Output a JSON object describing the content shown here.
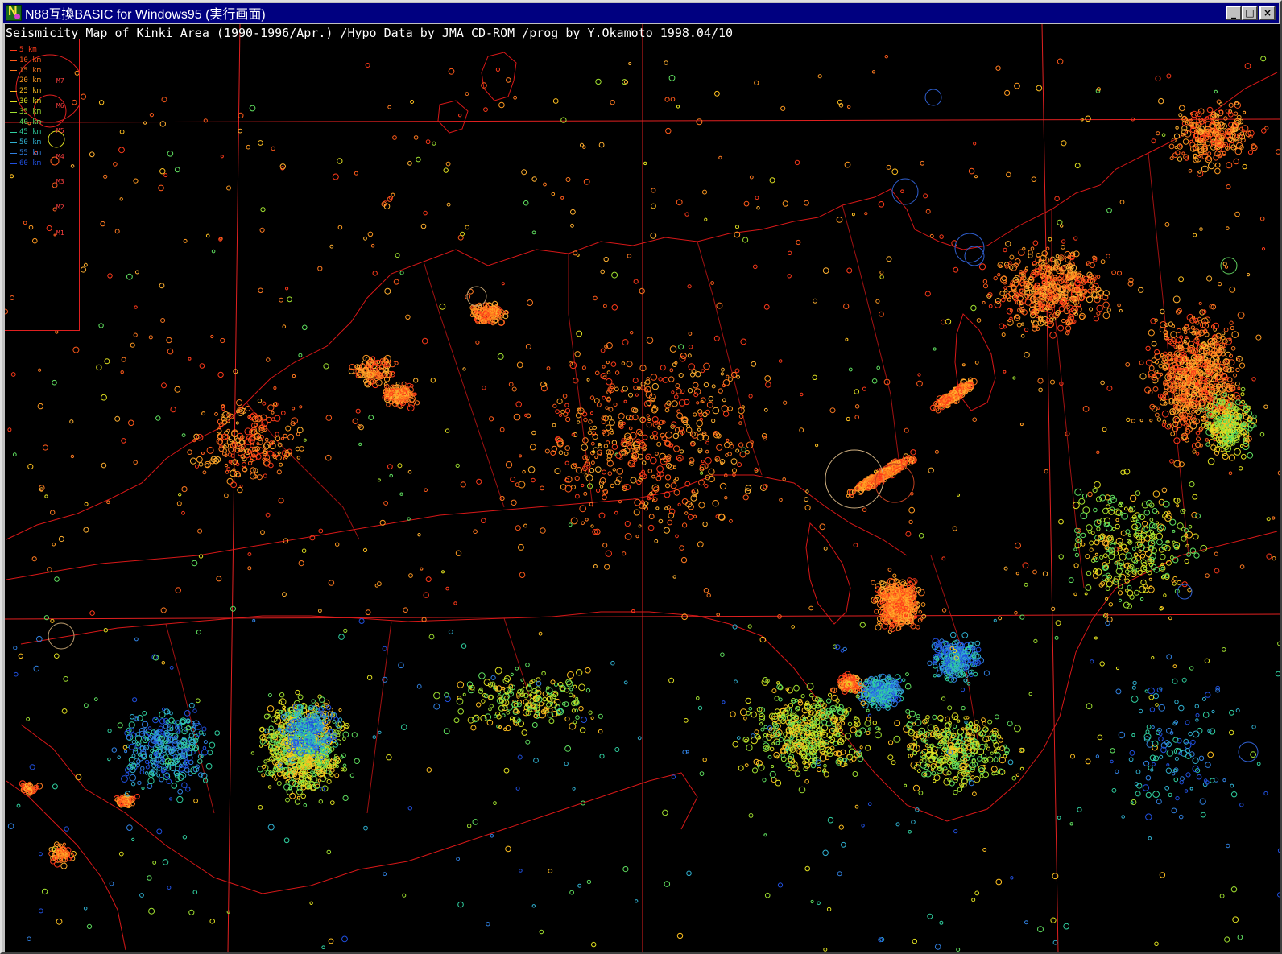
{
  "window": {
    "title": "N88互換BASIC for Windows95 (実行画面)",
    "buttons": {
      "minimize": "_",
      "maximize": "□",
      "close": "×"
    }
  },
  "map": {
    "title": "Seismicity Map of Kinki Area (1990-1996/Apr.) /Hypo Data by JMA CD-ROM /prog by Y.Okamoto 1998.04/10",
    "background": "#000000",
    "border_color": "#e02020",
    "coast_color": "#e02020"
  },
  "legend": {
    "depth": [
      {
        "label": "5 km",
        "color": "#ff3a1a"
      },
      {
        "label": "10 km",
        "color": "#ff5a1a"
      },
      {
        "label": "15 km",
        "color": "#ff7a20"
      },
      {
        "label": "20 km",
        "color": "#ff9a20"
      },
      {
        "label": "25 km",
        "color": "#ffc020"
      },
      {
        "label": "30 km",
        "color": "#e0e020"
      },
      {
        "label": "35 km",
        "color": "#a0e030"
      },
      {
        "label": "40 km",
        "color": "#60e060"
      },
      {
        "label": "45 km",
        "color": "#30d0a0"
      },
      {
        "label": "50 km",
        "color": "#30b0d0"
      },
      {
        "label": "55 km",
        "color": "#3080e0"
      },
      {
        "label": "60 km",
        "color": "#2050e0"
      }
    ],
    "magnitude": [
      "M7",
      "M6",
      "M5",
      "M4",
      "M3",
      "M2",
      "M1"
    ]
  }
}
